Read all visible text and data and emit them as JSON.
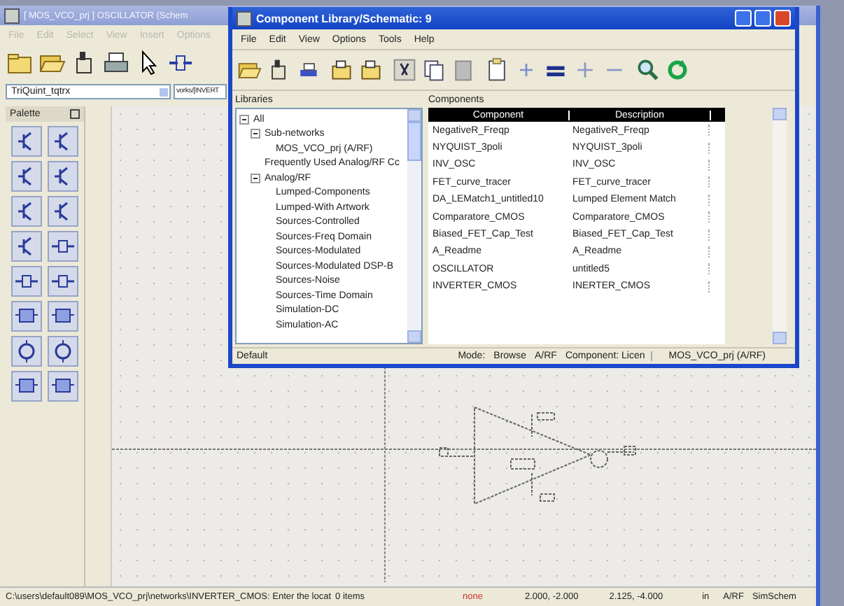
{
  "main_window": {
    "title": "[ MOS_VCO_prj ] OSCILLATOR (Schem",
    "active": false,
    "menu": [
      "File",
      "Edit",
      "Select",
      "View",
      "Insert",
      "Options"
    ],
    "library_combo": "TriQuint_tqtrx",
    "path_field": "vorks/[INVERT",
    "palette_title": "Palette",
    "status_bar": {
      "message": "C:\\users\\default089\\MOS_VCO_prj\\networks\\INVERTER_CMOS: Enter the locat",
      "items": "0 items",
      "mode": "none",
      "coord_1": "2.000, -2.000",
      "coord_2": "2.125, -4.000",
      "units": "in",
      "domain": "A/RF",
      "simulator": "SimSchem"
    }
  },
  "library_window": {
    "title": "Component Library/Schematic: 9",
    "active": true,
    "menu": [
      "File",
      "Edit",
      "View",
      "Options",
      "Tools",
      "Help"
    ],
    "libraries_label": "Libraries",
    "tree": [
      {
        "label": "All",
        "expanded": true,
        "children": [
          {
            "label": "Sub-networks",
            "expanded": true,
            "children": [
              {
                "label": "MOS_VCO_prj (A/RF)"
              }
            ]
          },
          {
            "label": "Frequently Used Analog/RF Cc"
          },
          {
            "label": "Analog/RF",
            "expanded": true,
            "children": [
              {
                "label": "Lumped-Components"
              },
              {
                "label": "Lumped-With Artwork"
              },
              {
                "label": "Sources-Controlled"
              },
              {
                "label": "Sources-Freq Domain"
              },
              {
                "label": "Sources-Modulated"
              },
              {
                "label": "Sources-Modulated DSP-B"
              },
              {
                "label": "Sources-Noise"
              },
              {
                "label": "Sources-Time Domain"
              },
              {
                "label": "Simulation-DC"
              },
              {
                "label": "Simulation-AC"
              }
            ]
          }
        ]
      }
    ],
    "components_label": "Components",
    "table": {
      "columns": [
        "Component",
        "Description"
      ],
      "rows": [
        [
          "NegativeR_Freqp",
          "NegativeR_Freqp"
        ],
        [
          "NYQUIST_3poli",
          "NYQUIST_3poli"
        ],
        [
          "INV_OSC",
          "INV_OSC"
        ],
        [
          "FET_curve_tracer",
          "FET_curve_tracer"
        ],
        [
          "DA_LEMatch1_untitled10",
          "Lumped Element Match"
        ],
        [
          "Comparatore_CMOS",
          "Comparatore_CMOS"
        ],
        [
          "Biased_FET_Cap_Test",
          "Biased_FET_Cap_Test"
        ],
        [
          "A_Readme",
          "A_Readme"
        ],
        [
          "OSCILLATOR",
          "untitled5"
        ],
        [
          "INVERTER_CMOS",
          "INERTER_CMOS"
        ]
      ]
    },
    "status_bar": {
      "library": "Default",
      "mode_label": "Mode:",
      "mode": "Browse",
      "domain": "A/RF",
      "component": "Component: Licen",
      "project": "MOS_VCO_prj (A/RF)"
    }
  }
}
